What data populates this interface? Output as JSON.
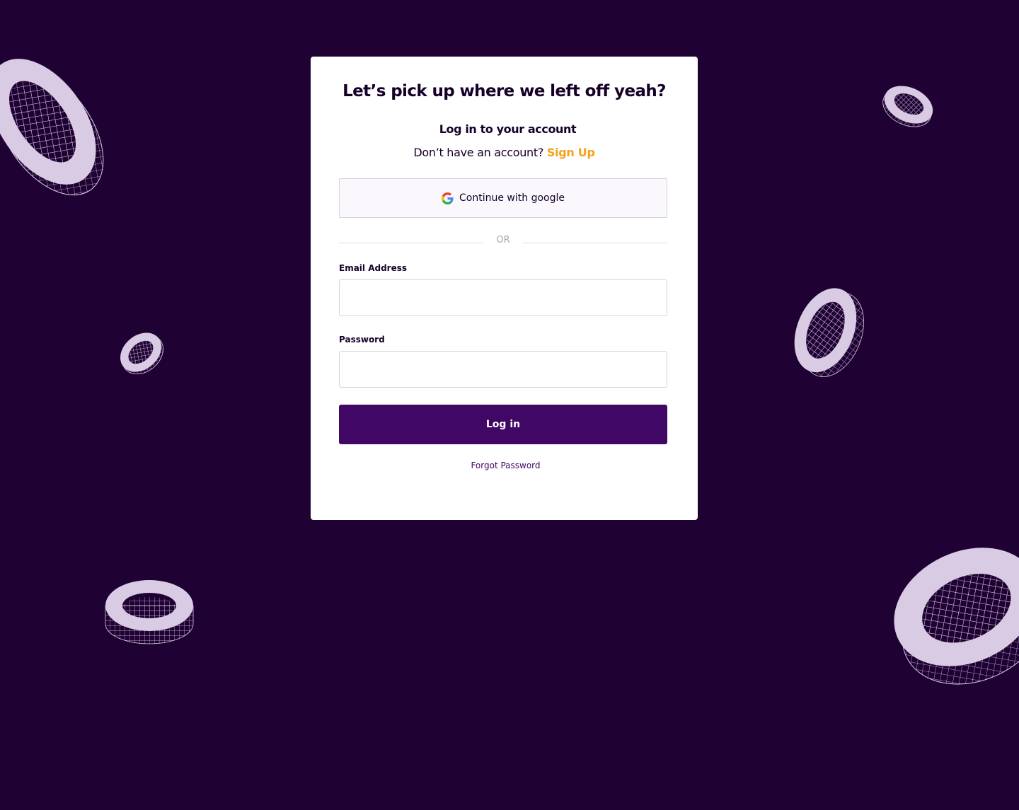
{
  "colors": {
    "background": "#1f0233",
    "card": "#ffffff",
    "primary": "#410764",
    "accent": "#f5a11c",
    "ring": "#d8cbe3"
  },
  "decoration": {
    "ring_count": 7,
    "ring_icon": "wireframe-torus"
  },
  "login": {
    "headline": "Let’s pick up where we left off yeah?",
    "subtitle": "Log in to your account",
    "signup_prompt": "Don’t have an account?",
    "signup_link": "Sign Up",
    "google_button_label": "Continue with google",
    "google_icon": "google-g-icon",
    "divider_text": "OR",
    "email_label": "Email Address",
    "email_value": "",
    "password_label": "Password",
    "password_value": "",
    "login_button_label": "Log in",
    "forgot_password_label": "Forgot Password"
  }
}
